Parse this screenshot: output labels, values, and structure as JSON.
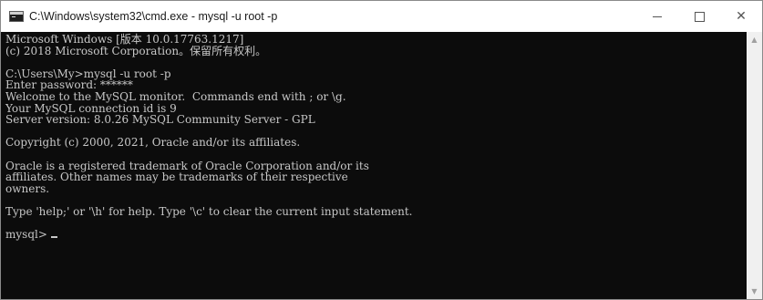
{
  "window": {
    "title": "C:\\Windows\\system32\\cmd.exe - mysql  -u root -p",
    "minimize_symbol": "",
    "maximize_symbol": "",
    "close_symbol": "✕"
  },
  "console": {
    "lines": [
      "Microsoft Windows [版本 10.0.17763.1217]",
      "(c) 2018 Microsoft Corporation。保留所有权利。",
      "",
      "C:\\Users\\My>mysql -u root -p",
      "Enter password: ******",
      "Welcome to the MySQL monitor.  Commands end with ; or \\g.",
      "Your MySQL connection id is 9",
      "Server version: 8.0.26 MySQL Community Server - GPL",
      "",
      "Copyright (c) 2000, 2021, Oracle and/or its affiliates.",
      "",
      "Oracle is a registered trademark of Oracle Corporation and/or its",
      "affiliates. Other names may be trademarks of their respective",
      "owners.",
      "",
      "Type 'help;' or '\\h' for help. Type '\\c' to clear the current input statement.",
      "",
      "mysql> "
    ]
  },
  "scrollbar": {
    "up_arrow": "▲",
    "down_arrow": "▼"
  }
}
